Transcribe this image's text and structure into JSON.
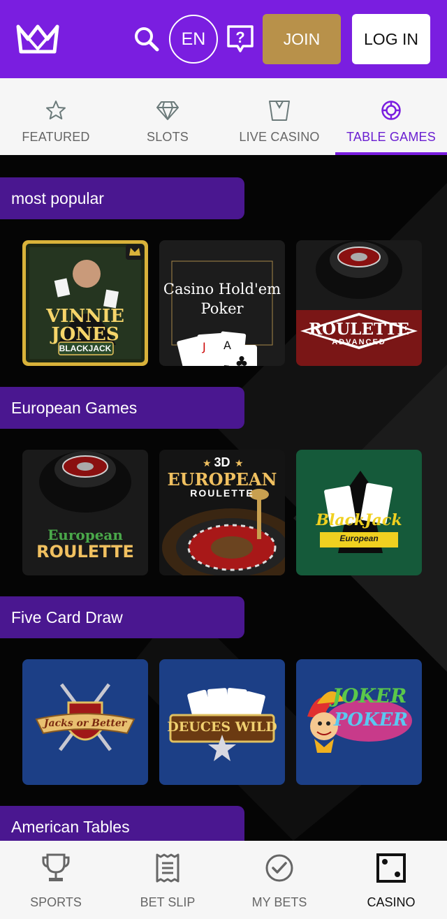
{
  "header": {
    "lang": "EN",
    "join_label": "JOIN",
    "login_label": "LOG IN"
  },
  "tabs": [
    {
      "label": "FEATURED",
      "icon": "star-icon"
    },
    {
      "label": "SLOTS",
      "icon": "diamond-icon"
    },
    {
      "label": "LIVE CASINO",
      "icon": "dealer-icon"
    },
    {
      "label": "TABLE GAMES",
      "icon": "chip-icon",
      "active": true
    }
  ],
  "sections": [
    {
      "title": "most popular",
      "games": [
        {
          "name": "Vinnie Jones Blackjack",
          "text_top": "VINNIE",
          "text_mid": "JONES",
          "text_badge": "BLACKJACK"
        },
        {
          "name": "Casino Hold'em Poker",
          "text_top": "Casino Hold'em",
          "text_mid": "Poker"
        },
        {
          "name": "Roulette Advanced",
          "text_top": "ROULETTE",
          "text_mid": "ADVANCED"
        }
      ]
    },
    {
      "title": "European Games",
      "games": [
        {
          "name": "European Roulette",
          "text_top": "European",
          "text_mid": "ROULETTE"
        },
        {
          "name": "3D European Roulette",
          "text_top": "3D",
          "text_mid": "EUROPEAN",
          "text_badge": "ROULETTE"
        },
        {
          "name": "Blackjack European",
          "text_top": "BlackJack",
          "text_mid": "European"
        }
      ]
    },
    {
      "title": "Five Card Draw",
      "games": [
        {
          "name": "Jacks or Better",
          "text_top": "Jacks or Better"
        },
        {
          "name": "Deuces Wild",
          "text_top": "DEUCES WILD"
        },
        {
          "name": "Joker Poker",
          "text_top": "JOKER",
          "text_mid": "POKER"
        }
      ]
    },
    {
      "title": "American Tables",
      "games": []
    }
  ],
  "bottom_nav": [
    {
      "label": "SPORTS",
      "icon": "trophy-icon"
    },
    {
      "label": "BET SLIP",
      "icon": "receipt-icon"
    },
    {
      "label": "MY BETS",
      "icon": "check-circle-icon"
    },
    {
      "label": "CASINO",
      "icon": "dice-icon",
      "active": true
    }
  ],
  "colors": {
    "brand": "#7a1ee0",
    "section": "#4a1790",
    "join": "#b8914a",
    "active_tab": "#6a1fd1"
  }
}
